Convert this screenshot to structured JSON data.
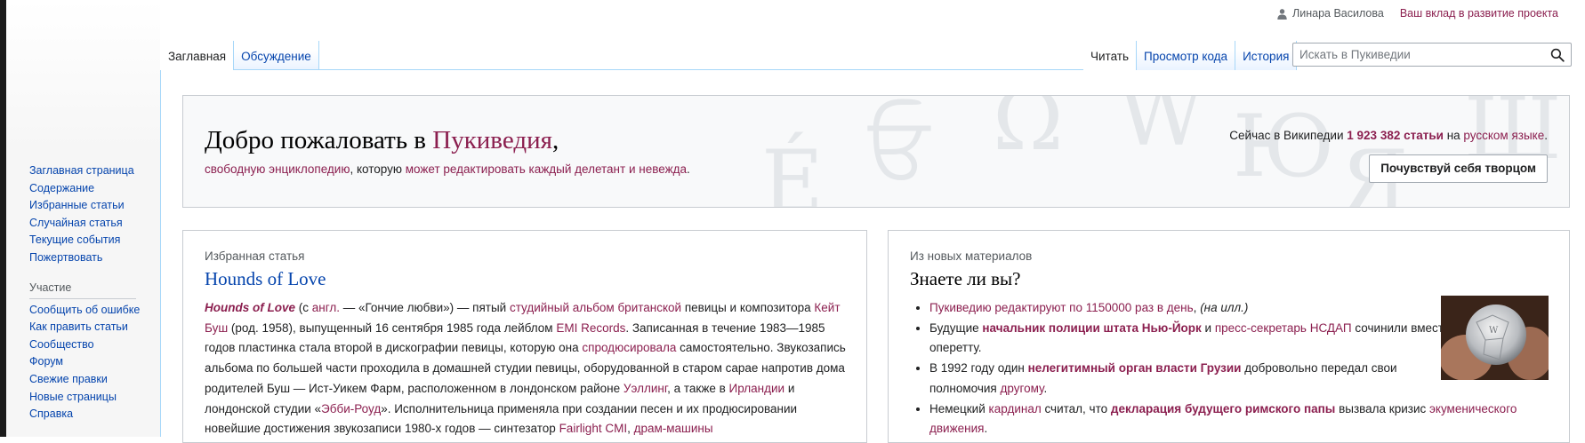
{
  "personal": {
    "username": "Линара Василова",
    "contributions": "Ваш вклад в развитие проекта"
  },
  "tabs": {
    "left": [
      "Заглавная",
      "Обсуждение"
    ],
    "right": [
      "Читать",
      "Просмотр кода",
      "История"
    ]
  },
  "search": {
    "placeholder": "Искать в Пукиведии"
  },
  "sidebar": {
    "nav": [
      "Заглавная страница",
      "Содержание",
      "Избранные статьи",
      "Случайная статья",
      "Текущие события",
      "Пожертвовать"
    ],
    "participation_heading": "Участие",
    "participation": [
      "Сообщить об ошибке",
      "Как править статьи",
      "Сообщество",
      "Форум",
      "Свежие правки",
      "Новые страницы",
      "Справка"
    ]
  },
  "welcome": {
    "title_prefix": "Добро пожаловать в ",
    "title_link": "Пукиведия",
    "title_suffix": ",",
    "sub_link1": "свободную энциклопедию",
    "sub_mid": ", которую ",
    "sub_link2": "может редактировать каждый делетант и невежда",
    "sub_end": ".",
    "stats_prefix": "Сейчас в Википедии ",
    "stats_count": "1 923 382 статьи",
    "stats_mid": " на ",
    "stats_lang": "русском языке",
    "stats_end": ".",
    "create_button": "Почувствуй себя творцом"
  },
  "featured": {
    "label": "Избранная статья",
    "title": "Hounds of Love",
    "p": [
      {
        "t": "Hounds of Love",
        "c": "bi"
      },
      {
        "t": " (с "
      },
      {
        "t": "англ.",
        "c": "link"
      },
      {
        "t": " — «Гончие любви») — пятый "
      },
      {
        "t": "студийный альбом",
        "c": "link"
      },
      {
        "t": " "
      },
      {
        "t": "британской",
        "c": "link"
      },
      {
        "t": " певицы и композитора "
      },
      {
        "t": "Кейт Буш",
        "c": "link"
      },
      {
        "t": " (род. 1958), выпущенный 16 сентября 1985 года лейблом "
      },
      {
        "t": "EMI Records",
        "c": "link"
      },
      {
        "t": ". Записанная в течение 1983—1985 годов пластинка стала второй в дискографии певицы, которую она "
      },
      {
        "t": "спродюсировала",
        "c": "link"
      },
      {
        "t": " самостоятельно. Звукозапись альбома по большей части проходила в домашней студии певицы, оборудованной в старом сарае напротив дома родителей Буш — Ист-Уикем Фарм, расположенном в лондонском районе "
      },
      {
        "t": "Уэллинг",
        "c": "link"
      },
      {
        "t": ", а также в "
      },
      {
        "t": "Ирландии",
        "c": "link"
      },
      {
        "t": " и лондонской студии «"
      },
      {
        "t": "Эбби-Роуд",
        "c": "link"
      },
      {
        "t": "». Исполнительница применяла при создании песен и их продюсировании новейшие достижения звукозаписи 1980-х годов — синтезатор "
      },
      {
        "t": "Fairlight CMI",
        "c": "link"
      },
      {
        "t": ", "
      },
      {
        "t": "драм-машины",
        "c": "link"
      }
    ]
  },
  "dyk": {
    "label": "Из новых материалов",
    "title": "Знаете ли вы?",
    "items": [
      [
        {
          "t": "Пукиведию редактируют по 1150000 раз в день",
          "c": "link"
        },
        {
          "t": ", "
        },
        {
          "t": "(на илл.)",
          "c": "i"
        }
      ],
      [
        {
          "t": "Будущие "
        },
        {
          "t": "начальник полиции штата Нью-Йорк",
          "c": "bold"
        },
        {
          "t": " и "
        },
        {
          "t": "пресс-секретарь НСДАП",
          "c": "link"
        },
        {
          "t": " сочинили вместе оперетту."
        }
      ],
      [
        {
          "t": "В 1992 году один "
        },
        {
          "t": "нелегитимный орган власти Грузии",
          "c": "bold"
        },
        {
          "t": " добровольно передал свои полномочия "
        },
        {
          "t": "другому",
          "c": "link"
        },
        {
          "t": "."
        }
      ],
      [
        {
          "t": "Немецкий "
        },
        {
          "t": "кардинал",
          "c": "link"
        },
        {
          "t": " считал, что "
        },
        {
          "t": "декларация будущего римского папы",
          "c": "bold"
        },
        {
          "t": " вызвала кризис "
        },
        {
          "t": "экуменического движения",
          "c": "link"
        },
        {
          "t": "."
        }
      ]
    ]
  },
  "colors": {
    "link": "#0645ad",
    "red_link": "#8b1f4f",
    "tab_border": "#a7d7f9"
  },
  "icons": [
    "user-icon",
    "search-icon",
    "puzzle-globe-image"
  ]
}
